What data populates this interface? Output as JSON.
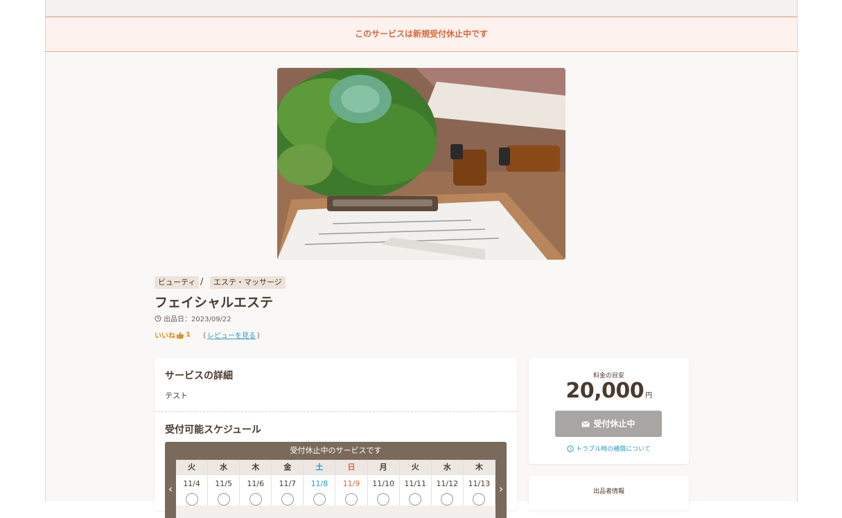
{
  "notice": "このサービスは新規受付休止中です",
  "breadcrumb": {
    "category": "ビューティ",
    "separator": "/",
    "subcategory": "エステ・マッサージ"
  },
  "service": {
    "title": "フェイシャルエステ",
    "date_label": "出品日：2023/09/22",
    "likes_label": "いいね",
    "likes_count": "1",
    "review_link": "レビューを見る",
    "review_open": "（",
    "review_close": "）"
  },
  "details": {
    "title": "サービスの詳細",
    "text": "テスト"
  },
  "schedule": {
    "title": "受付可能スケジュール",
    "banner": "受付休止中のサービスです",
    "prev": "‹",
    "next": "›",
    "days": [
      {
        "dow": "火",
        "date": "11/4",
        "type": "weekday"
      },
      {
        "dow": "水",
        "date": "11/5",
        "type": "weekday"
      },
      {
        "dow": "木",
        "date": "11/6",
        "type": "weekday"
      },
      {
        "dow": "金",
        "date": "11/7",
        "type": "weekday"
      },
      {
        "dow": "土",
        "date": "11/8",
        "type": "sat"
      },
      {
        "dow": "日",
        "date": "11/9",
        "type": "sun"
      },
      {
        "dow": "月",
        "date": "11/10",
        "type": "weekday"
      },
      {
        "dow": "火",
        "date": "11/11",
        "type": "weekday"
      },
      {
        "dow": "水",
        "date": "11/12",
        "type": "weekday"
      },
      {
        "dow": "木",
        "date": "11/13",
        "type": "weekday"
      }
    ]
  },
  "pricing": {
    "label": "料金の目安",
    "amount": "20,000",
    "currency": "円",
    "button": "受付休止中",
    "help": "トラブル時の補償について"
  },
  "seller": {
    "title": "出品者情報"
  },
  "colors": {
    "accent": "#d9673c",
    "link": "#2a9ac8",
    "text": "#4a3a2e",
    "disabled": "#a7a6a4"
  },
  "icons": {
    "clock": "clock-icon",
    "thumb": "thumbs-up-icon",
    "mail": "mail-icon",
    "help": "question-circle-icon"
  }
}
